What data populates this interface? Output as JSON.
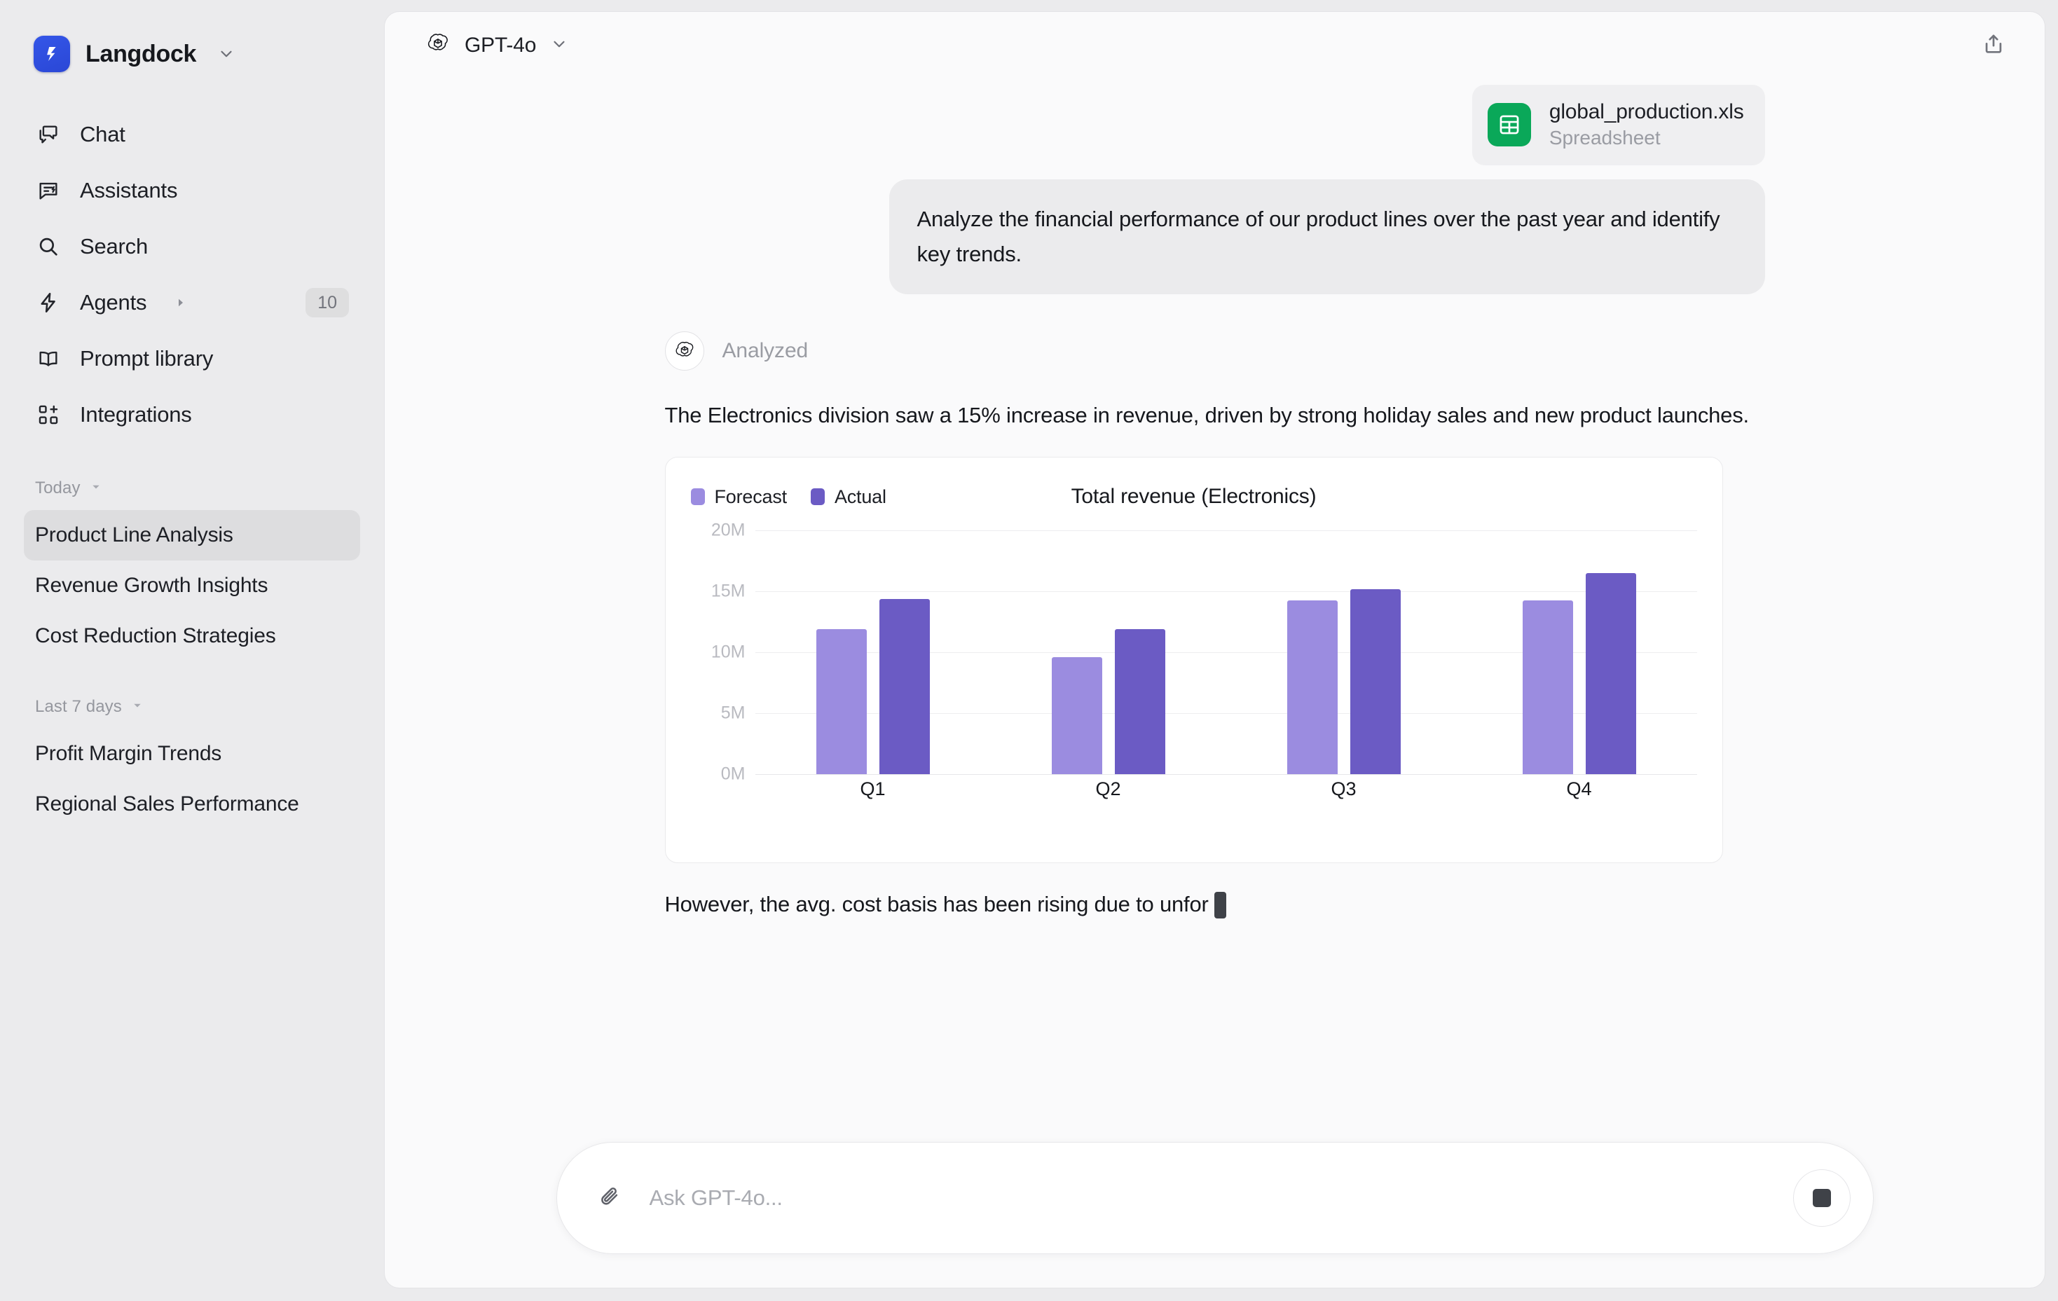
{
  "brand": {
    "name": "Langdock",
    "logo_icon": "langdock-logo-icon",
    "caret_icon": "chevron-down-icon"
  },
  "sidebar": {
    "nav": [
      {
        "label": "Chat",
        "icon": "chat-bubbles-icon"
      },
      {
        "label": "Assistants",
        "icon": "assistant-bubble-icon"
      },
      {
        "label": "Search",
        "icon": "search-icon"
      },
      {
        "label": "Agents",
        "icon": "lightning-bolt-icon",
        "expand_icon": "caret-right-icon",
        "badge": "10"
      },
      {
        "label": "Prompt library",
        "icon": "book-open-icon"
      },
      {
        "label": "Integrations",
        "icon": "grid-plus-icon"
      }
    ],
    "groups": [
      {
        "title": "Today",
        "caret_icon": "caret-down-icon",
        "items": [
          {
            "label": "Product Line Analysis",
            "active": true
          },
          {
            "label": "Revenue Growth Insights",
            "active": false
          },
          {
            "label": "Cost Reduction Strategies",
            "active": false
          }
        ]
      },
      {
        "title": "Last 7 days",
        "caret_icon": "caret-down-icon",
        "items": [
          {
            "label": "Profit Margin Trends",
            "active": false
          },
          {
            "label": "Regional Sales Performance",
            "active": false
          }
        ]
      }
    ]
  },
  "topbar": {
    "model_name": "GPT-4o",
    "model_icon": "openai-logo-icon",
    "model_caret_icon": "chevron-down-icon",
    "share_icon": "share-upload-icon"
  },
  "conversation": {
    "attachment": {
      "filename": "global_production.xls",
      "filetype": "Spreadsheet",
      "icon": "spreadsheet-icon",
      "icon_color": "#0aa859"
    },
    "user_message": "Analyze the financial performance of our product lines over the past year and identify key trends.",
    "assistant": {
      "avatar_icon": "openai-logo-icon",
      "status": "Analyzed",
      "paragraph": "The Electronics division saw a 15% increase in revenue, driven by strong holiday sales and new product launches.",
      "streaming_text": "However, the avg. cost basis has been rising due to unfor",
      "cursor": "text-caret-block"
    }
  },
  "composer": {
    "attach_icon": "paperclip-icon",
    "placeholder": "Ask GPT-4o...",
    "value": "",
    "stop_icon": "stop-square-icon"
  },
  "chart_data": {
    "type": "bar",
    "title": "Total revenue (Electronics)",
    "xlabel": "",
    "ylabel": "",
    "categories": [
      "Q1",
      "Q2",
      "Q3",
      "Q4"
    ],
    "series": [
      {
        "name": "Forecast",
        "color": "#9b8ce0",
        "values": [
          11.9,
          9.6,
          14.3,
          14.3
        ]
      },
      {
        "name": "Actual",
        "color": "#6b5bc4",
        "values": [
          14.4,
          11.9,
          15.2,
          16.5
        ]
      }
    ],
    "ylim": [
      0,
      20
    ],
    "yticks": [
      20,
      15,
      10,
      5,
      0
    ],
    "ytick_labels": [
      "20M",
      "15M",
      "10M",
      "5M",
      "0M"
    ],
    "grid": true,
    "legend_position": "top-left",
    "unit": "M"
  }
}
